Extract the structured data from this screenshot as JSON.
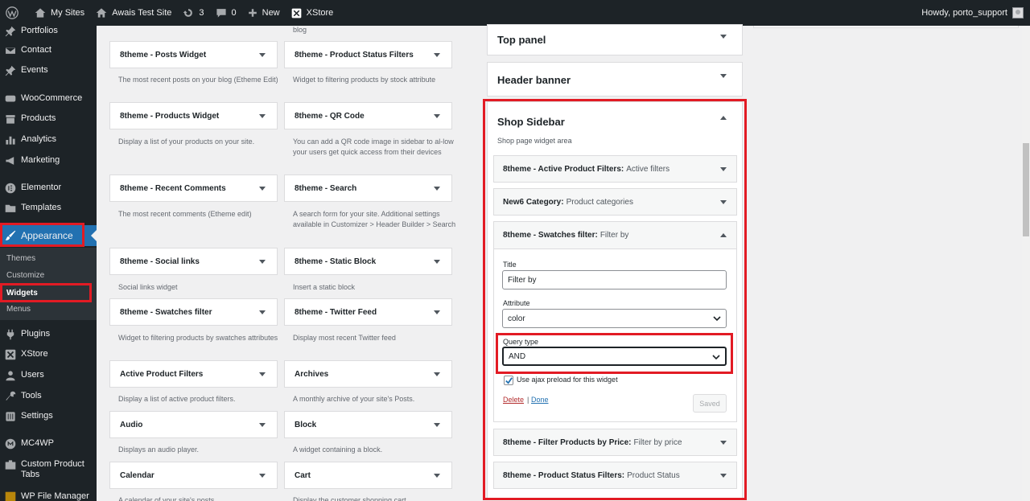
{
  "admin_bar": {
    "my_sites": "My Sites",
    "site_name": "Awais Test Site",
    "updates_count": "3",
    "comments_count": "0",
    "new_label": "New",
    "xstore_label": "XStore",
    "greeting": "Howdy, porto_support"
  },
  "sidebar": {
    "items": [
      {
        "label": "Portfolios",
        "icon": "pin-icon"
      },
      {
        "label": "Contact",
        "icon": "mail-icon"
      },
      {
        "label": "Events",
        "icon": "pin-icon"
      },
      {
        "label": "WooCommerce",
        "icon": "woo-icon"
      },
      {
        "label": "Products",
        "icon": "archive-icon"
      },
      {
        "label": "Analytics",
        "icon": "chart-icon"
      },
      {
        "label": "Marketing",
        "icon": "megaphone-icon"
      },
      {
        "label": "Elementor",
        "icon": "elementor-icon"
      },
      {
        "label": "Templates",
        "icon": "folder-icon"
      },
      {
        "label": "Appearance",
        "icon": "brush-icon"
      },
      {
        "label": "Plugins",
        "icon": "plugin-icon"
      },
      {
        "label": "XStore",
        "icon": "xstore-icon"
      },
      {
        "label": "Users",
        "icon": "users-icon"
      },
      {
        "label": "Tools",
        "icon": "wrench-icon"
      },
      {
        "label": "Settings",
        "icon": "settings-icon"
      },
      {
        "label": "MC4WP",
        "icon": "mc4wp-icon"
      },
      {
        "label": "Custom Product Tabs",
        "icon": "tabs-icon"
      },
      {
        "label": "WP File Manager",
        "icon": "file-manager-icon"
      }
    ],
    "submenu": [
      "Themes",
      "Customize",
      "Widgets",
      "Menus"
    ]
  },
  "widgets_top_desc": "blog",
  "available_widgets": [
    {
      "left": {
        "title": "8theme - Posts Widget",
        "desc": "The most recent posts on your blog (Etheme Edit)"
      },
      "right": {
        "title": "8theme - Product Status Filters",
        "desc": "Widget to filtering products by stock attribute"
      }
    },
    {
      "left": {
        "title": "8theme - Products Widget",
        "desc": "Display a list of your products on your site."
      },
      "right": {
        "title": "8theme - QR Code",
        "desc": "You can add a QR code image in sidebar to al-low your users get quick access from their devices"
      }
    },
    {
      "left": {
        "title": "8theme - Recent Comments",
        "desc": "The most recent comments (Etheme edit)"
      },
      "right": {
        "title": "8theme - Search",
        "desc": "A search form for your site. Additional settings available in Customizer > Header Builder > Search"
      }
    },
    {
      "left": {
        "title": "8theme - Social links",
        "desc": "Social links widget"
      },
      "right": {
        "title": "8theme - Static Block",
        "desc": "Insert a static block"
      }
    },
    {
      "left": {
        "title": "8theme - Swatches filter",
        "desc": "Widget to filtering products by swatches attributes"
      },
      "right": {
        "title": "8theme - Twitter Feed",
        "desc": "Display most recent Twitter feed"
      }
    },
    {
      "left": {
        "title": "Active Product Filters",
        "desc": "Display a list of active product filters."
      },
      "right": {
        "title": "Archives",
        "desc": "A monthly archive of your site's Posts."
      }
    },
    {
      "left": {
        "title": "Audio",
        "desc": "Displays an audio player."
      },
      "right": {
        "title": "Block",
        "desc": "A widget containing a block."
      }
    },
    {
      "left": {
        "title": "Calendar",
        "desc": "A calendar of your site's posts."
      },
      "right": {
        "title": "Cart",
        "desc": "Display the customer shopping cart."
      }
    }
  ],
  "sidebars": {
    "top_panel": "Top panel",
    "header_banner": "Header banner",
    "shop_sidebar": {
      "title": "Shop Sidebar",
      "desc": "Shop page widget area",
      "widgets": [
        {
          "name": "8theme - Active Product Filters:",
          "subtitle": "Active filters"
        },
        {
          "name": "New6 Category:",
          "subtitle": "Product categories"
        },
        {
          "name": "8theme - Swatches filter:",
          "subtitle": "Filter by"
        },
        {
          "name": "8theme - Filter Products by Price:",
          "subtitle": "Filter by price"
        },
        {
          "name": "8theme - Product Status Filters:",
          "subtitle": "Product Status"
        }
      ],
      "form": {
        "title_label": "Title",
        "title_value": "Filter by",
        "attribute_label": "Attribute",
        "attribute_value": "color",
        "query_type_label": "Query type",
        "query_type_value": "AND",
        "ajax_label": "Use ajax preload for this widget",
        "ajax_checked": true,
        "delete_label": "Delete",
        "separator": "|",
        "done_label": "Done",
        "saved_label": "Saved"
      }
    }
  },
  "colors": {
    "highlight_red": "#e21b24",
    "wp_blue": "#2271b1",
    "admin_dark": "#1d2327"
  }
}
